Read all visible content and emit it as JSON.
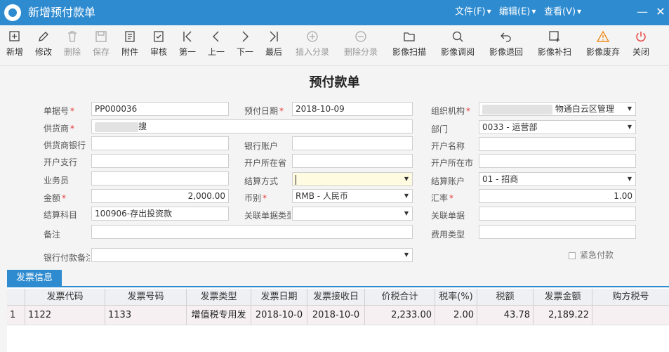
{
  "window": {
    "title": "新增预付款单",
    "menus": [
      "文件(F)",
      "编辑(E)",
      "查看(V)"
    ],
    "controls": [
      "minimize-icon",
      "close-icon"
    ]
  },
  "toolbar": [
    {
      "label": "新增",
      "icon": "add-icon",
      "enabled": true
    },
    {
      "label": "修改",
      "icon": "edit-icon",
      "enabled": true
    },
    {
      "label": "删除",
      "icon": "trash-icon",
      "enabled": false
    },
    {
      "label": "保存",
      "icon": "save-icon",
      "enabled": false
    },
    {
      "label": "附件",
      "icon": "attachment-icon",
      "enabled": true
    },
    {
      "label": "审核",
      "icon": "audit-icon",
      "enabled": true
    },
    {
      "label": "第一",
      "icon": "first-icon",
      "enabled": true
    },
    {
      "label": "上一",
      "icon": "prev-icon",
      "enabled": true
    },
    {
      "label": "下一",
      "icon": "next-icon",
      "enabled": true
    },
    {
      "label": "最后",
      "icon": "last-icon",
      "enabled": true
    },
    {
      "label": "插入分录",
      "icon": "insert-row-icon",
      "enabled": false
    },
    {
      "label": "删除分录",
      "icon": "delete-row-icon",
      "enabled": false
    },
    {
      "label": "影像扫描",
      "icon": "folder-icon",
      "enabled": true
    },
    {
      "label": "影像调阅",
      "icon": "search-icon",
      "enabled": true
    },
    {
      "label": "影像退回",
      "icon": "undo-icon",
      "enabled": true
    },
    {
      "label": "影像补扫",
      "icon": "image-add-icon",
      "enabled": true
    },
    {
      "label": "影像废弃",
      "icon": "warning-icon",
      "enabled": true
    },
    {
      "label": "关闭",
      "icon": "power-icon",
      "enabled": true
    }
  ],
  "form": {
    "title": "预付款单",
    "doc_no_label": "单据号",
    "doc_no": "PP000036",
    "prepay_date_label": "预付日期",
    "prepay_date": "2018-10-09",
    "org_label": "组织机构",
    "org_value": "物通白云区管理",
    "supplier_label": "供货商",
    "supplier_value": "搜",
    "dept_label": "部门",
    "dept_value": "0033 - 运营部",
    "supplier_bank_label": "供货商银行",
    "bank_account_label": "银行账户",
    "account_name_label": "开户名称",
    "branch_label": "开户支行",
    "province_label": "开户所在省",
    "city_label": "开户所在市",
    "salesman_label": "业务员",
    "settle_method_label": "结算方式",
    "settle_account_label": "结算账户",
    "settle_account": "01 - 招商",
    "amount_label": "金额",
    "amount": "2,000.00",
    "currency_label": "币别",
    "currency": "RMB - 人民币",
    "rate_label": "汇率",
    "rate": "1.00",
    "subject_label": "结算科目",
    "subject": "100906-存出投资款",
    "related_type_label": "关联单据类型",
    "related_doc_label": "关联单据",
    "remark_label": "备注",
    "fee_type_label": "费用类型",
    "bank_remark_label": "银行付款备注",
    "urgent_label": "紧急付款"
  },
  "tabs": {
    "invoice": "发票信息"
  },
  "grid": {
    "columns": [
      "",
      "发票代码",
      "发票号码",
      "发票类型",
      "发票日期",
      "发票接收日",
      "价税合计",
      "税率(%)",
      "税额",
      "发票金额",
      "购方税号"
    ],
    "rows": [
      [
        "1",
        "1122",
        "1133",
        "增值税专用发",
        "2018-10-0",
        "2018-10-0",
        "2,233.00",
        "2.00",
        "43.78",
        "2,189.22",
        ""
      ]
    ]
  },
  "colors": {
    "accent": "#2e8bd0",
    "required": "#e53935",
    "highlight_field": "#fffbe0"
  }
}
